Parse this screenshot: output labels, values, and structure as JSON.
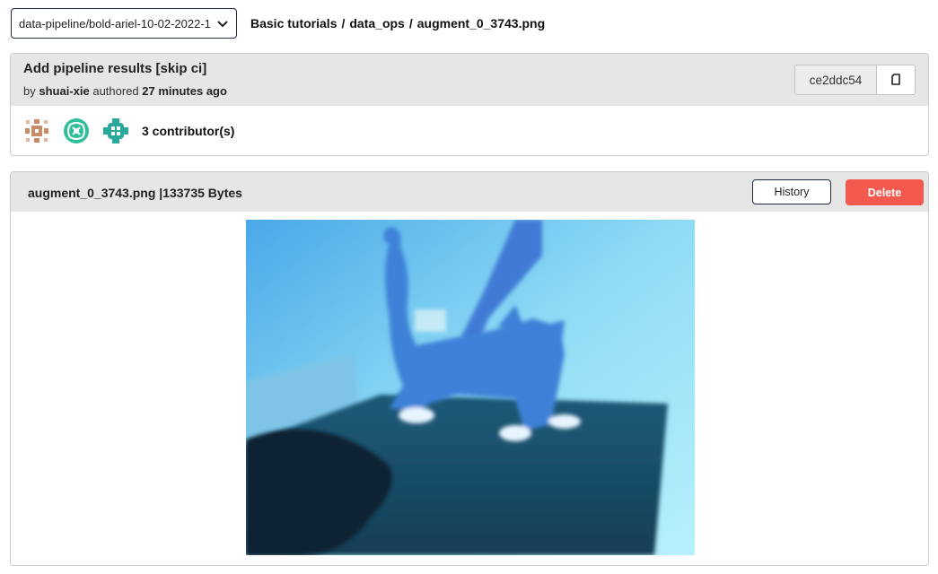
{
  "breadcrumb": {
    "branch": "data-pipeline/bold-ariel-10-02-2022-1",
    "path": [
      "Basic tutorials",
      "data_ops",
      "augment_0_3743.png"
    ]
  },
  "commit": {
    "title": "Add pipeline results [skip ci]",
    "by_prefix": "by",
    "author": "shuai-xie",
    "authored_word": "authored",
    "time_ago": "27 minutes ago",
    "sha": "ce2ddc54",
    "contributors_label": "3 contributor(s)"
  },
  "file": {
    "header": "augment_0_3743.png |133735 Bytes",
    "history_label": "History",
    "delete_label": "Delete"
  },
  "colors": {
    "delete": "#f25a4f",
    "header_bg": "#e6e6e6",
    "avatar1": "#c98a66",
    "avatar2": "#2fbf9a",
    "avatar3": "#2aa89a"
  },
  "icons": [
    "chevron-down-icon",
    "copy-icon"
  ]
}
